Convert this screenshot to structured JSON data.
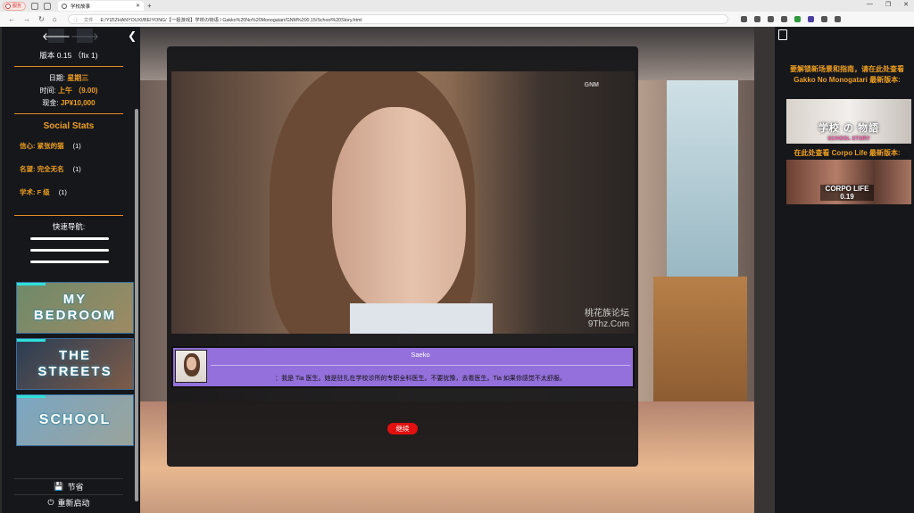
{
  "browser": {
    "profile_label": "服务",
    "tab_title": "学校故事",
    "url_prefix": "文件",
    "url": "E:/YIZIZHANYOUXI/BEIYONG/【一姐游戏】学校の物语 I Gakko%20No%20Monogatari/GNM%200.15/School%20Story.html"
  },
  "sidebar": {
    "version": "版本 0.15 （fix 1)",
    "day_label": "日期:",
    "day_value": "星期三",
    "time_label": "时间:",
    "time_value": "上午 （9.00)",
    "cash_label": "现金:",
    "cash_value": "JP¥10,000",
    "social_title": "Social Stats",
    "stats": [
      {
        "name": "信心: 紧张的猫",
        "value": "(1)"
      },
      {
        "name": "名望: 完全无名",
        "value": "(1)"
      },
      {
        "name": "学术: F 级",
        "value": "(1)"
      }
    ],
    "quick_nav": "快速导航:",
    "cards": [
      {
        "label": "MY BEDROOM",
        "colors": [
          "#6e8a6a",
          "#9e8a63"
        ]
      },
      {
        "label": "THE STREETS",
        "colors": [
          "#2a3d55",
          "#7e5c48"
        ]
      },
      {
        "label": "SCHOOL",
        "colors": [
          "#7aa6c4",
          "#9aa39a"
        ]
      }
    ],
    "save_label": "节省",
    "restart_label": "重新启动"
  },
  "dialog": {
    "brand": "GNM",
    "watermark_1": "桃花族论坛",
    "watermark_2": "9Thz.Com",
    "speaker": "Saeko",
    "text": "：我是 Tia 医生。她是驻扎在学校诊所的专职全科医生。不要犹豫，去看医生。Tia 如果你感觉不太舒服。",
    "continue_label": "继续"
  },
  "right_panel": {
    "ad1_title": "要解锁新场景和指南，请在此处查看 Gakko No Monogatari 最新版本:",
    "ad1_caption": "学校 の 物語",
    "ad1_sub": "SCHOOL STORY",
    "ad2_title": "在此处查看 Corpo Life 最新版本:",
    "ad2_caption": "CORPO LIFE 0.19"
  }
}
